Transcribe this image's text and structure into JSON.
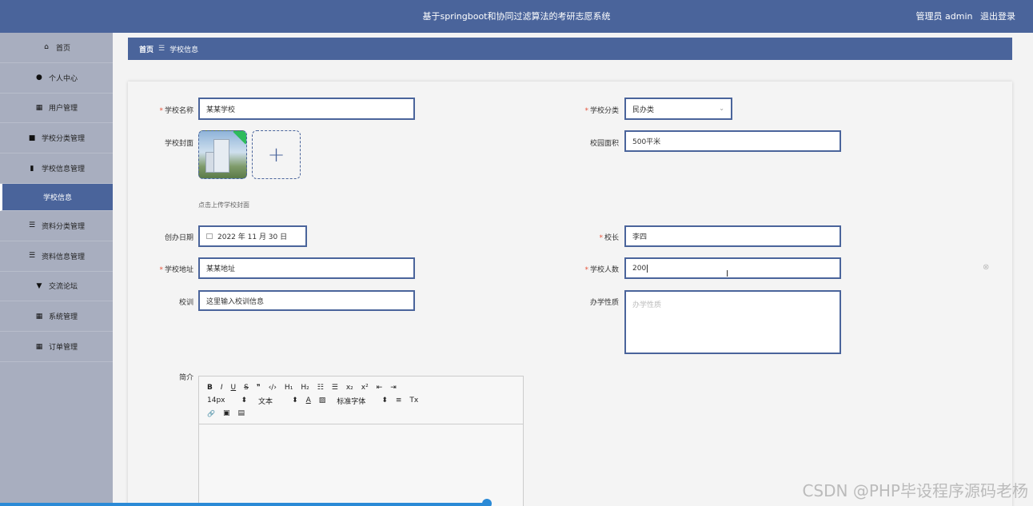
{
  "header": {
    "title": "基于springboot和协同过滤算法的考研志愿系统",
    "user_label": "管理员 admin",
    "logout": "退出登录"
  },
  "sidebar": {
    "items": [
      {
        "label": "首页",
        "icon": "home-icon"
      },
      {
        "label": "个人中心",
        "icon": "user-icon"
      },
      {
        "label": "用户管理",
        "icon": "grid-icon"
      },
      {
        "label": "学校分类管理",
        "icon": "video-icon"
      },
      {
        "label": "学校信息管理",
        "icon": "clipboard-icon"
      },
      {
        "label": "学校信息",
        "icon": ""
      },
      {
        "label": "资料分类管理",
        "icon": "list-icon"
      },
      {
        "label": "资料信息管理",
        "icon": "list-icon"
      },
      {
        "label": "交流论坛",
        "icon": "podium-icon"
      },
      {
        "label": "系统管理",
        "icon": "grid-icon"
      },
      {
        "label": "订单管理",
        "icon": "grid-icon"
      }
    ]
  },
  "breadcrumb": {
    "home": "首页",
    "sep": "☰",
    "current": "学校信息"
  },
  "form": {
    "school_name": {
      "label": "学校名称",
      "value": "某某学校",
      "required": true
    },
    "school_category": {
      "label": "学校分类",
      "value": "民办类",
      "required": true
    },
    "cover": {
      "label": "学校封面",
      "hint": "点击上传学校封面"
    },
    "campus_area": {
      "label": "校园面积",
      "value": "500平米"
    },
    "founded_date": {
      "label": "创办日期",
      "value": "2022 年 11 月 30 日"
    },
    "principal": {
      "label": "校长",
      "value": "李四",
      "required": true
    },
    "address": {
      "label": "学校地址",
      "value": "某某地址",
      "required": true
    },
    "student_count": {
      "label": "学校人数",
      "value": "200",
      "required": true
    },
    "motto": {
      "label": "校训",
      "value": "这里输入校训信息"
    },
    "nature": {
      "label": "办学性质",
      "placeholder": "办学性质"
    },
    "intro": {
      "label": "简介"
    }
  },
  "editor": {
    "row1": [
      "B",
      "I",
      "U",
      "S",
      "❞",
      "‹/›",
      "H₁",
      "H₂",
      "☷",
      "☰",
      "x₂",
      "x²",
      "⇤",
      "⇥"
    ],
    "row2": [
      "14px",
      "⬍",
      "文本",
      "⬍",
      "A",
      "▨",
      "标准字体",
      "⬍",
      "≡",
      "Tx"
    ],
    "row3": [
      "🔗",
      "▣",
      "▤"
    ]
  },
  "watermark": "CSDN @PHP毕设程序源码老杨",
  "colors": {
    "primary": "#4a649b",
    "required": "#e5533a"
  }
}
